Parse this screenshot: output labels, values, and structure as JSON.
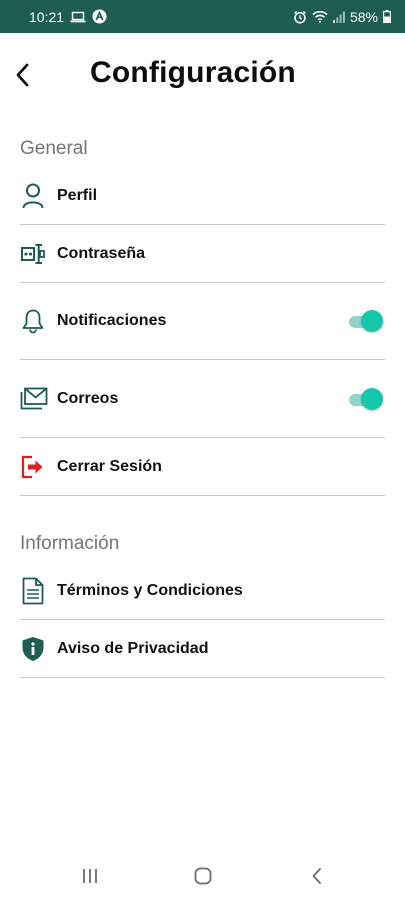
{
  "status_bar": {
    "time": "10:21",
    "battery": "58%",
    "icons": [
      "laptop-icon",
      "app-badge-icon",
      "alarm-icon",
      "wifi-icon",
      "signal-icon",
      "battery-icon"
    ],
    "background": "#1e5d51"
  },
  "header": {
    "title": "Configuración",
    "back_icon": "chevron-left-icon"
  },
  "sections": [
    {
      "label": "General",
      "items": [
        {
          "label": "Perfil",
          "icon": "user-icon",
          "icon_color": "#1e5d51"
        },
        {
          "label": "Contraseña",
          "icon": "password-icon",
          "icon_color": "#1e5d51"
        },
        {
          "label": "Notificaciones",
          "icon": "bell-icon",
          "icon_color": "#1e5d51",
          "toggle": true
        },
        {
          "label": "Correos",
          "icon": "mail-icon",
          "icon_color": "#1e5d51",
          "toggle": true
        },
        {
          "label": "Cerrar Sesión",
          "icon": "logout-icon",
          "icon_color": "#e02020"
        }
      ]
    },
    {
      "label": "Información",
      "items": [
        {
          "label": "Términos y Condiciones",
          "icon": "document-icon",
          "icon_color": "#1e5d51"
        },
        {
          "label": "Aviso de Privacidad",
          "icon": "shield-info-icon",
          "icon_color": "#1e5d51"
        }
      ]
    }
  ],
  "toggle_color": "#17c7aa",
  "nav_bar": {
    "buttons": [
      "recent-apps-icon",
      "home-icon",
      "back-icon"
    ]
  }
}
